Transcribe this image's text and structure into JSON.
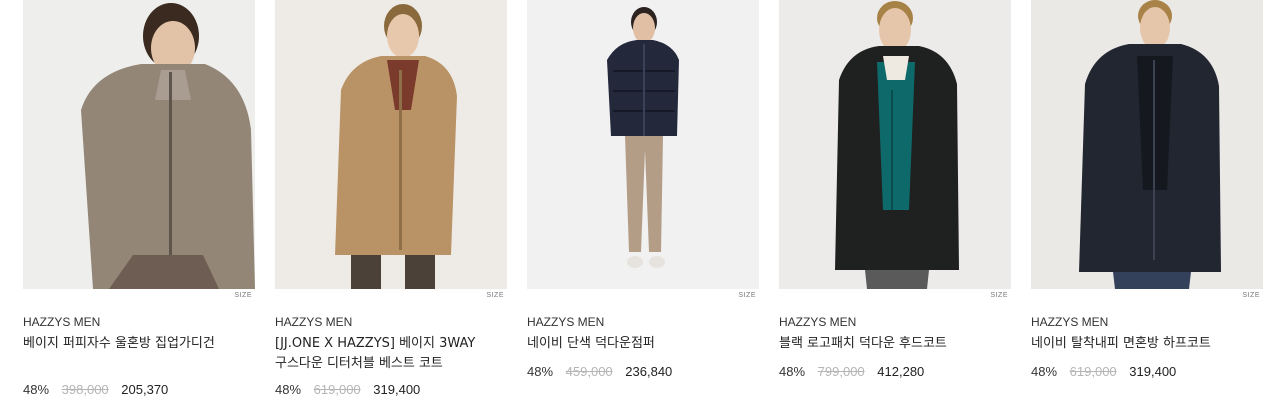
{
  "products": [
    {
      "size_label": "SIZE",
      "brand": "HAZZYS MEN",
      "name": "베이지 퍼피자수 울혼방 집업가디건",
      "discount": "48%",
      "original_price": "398,000",
      "sale_price": "205,370",
      "image_bg": "#eeeeec",
      "garment_color": "#938677",
      "pants_color": "#6e5d52"
    },
    {
      "size_label": "SIZE",
      "brand": "HAZZYS MEN",
      "name": "[JJ.ONE X HAZZYS] 베이지 3WAY 구스다운 디터처블 베스트 코트",
      "discount": "48%",
      "original_price": "619,000",
      "sale_price": "319,400",
      "image_bg": "#eeebe6",
      "garment_color": "#b99366",
      "pants_color": "#4c4138"
    },
    {
      "size_label": "SIZE",
      "brand": "HAZZYS MEN",
      "name": "네이비 단색 덕다운점퍼",
      "discount": "48%",
      "original_price": "459,000",
      "sale_price": "236,840",
      "image_bg": "#f1f1f2",
      "garment_color": "#23283a",
      "pants_color": "#b49d86"
    },
    {
      "size_label": "SIZE",
      "brand": "HAZZYS MEN",
      "name": "블랙 로고패치 덕다운 후드코트",
      "discount": "48%",
      "original_price": "799,000",
      "sale_price": "412,280",
      "image_bg": "#ecebe9",
      "garment_color": "#1f2020",
      "pants_color": "#5a5a5a"
    },
    {
      "size_label": "SIZE",
      "brand": "HAZZYS MEN",
      "name": "네이비 탈착내피 면혼방 하프코트",
      "discount": "48%",
      "original_price": "619,000",
      "sale_price": "319,400",
      "image_bg": "#ebe9e6",
      "garment_color": "#222631",
      "pants_color": "#34415a"
    }
  ]
}
